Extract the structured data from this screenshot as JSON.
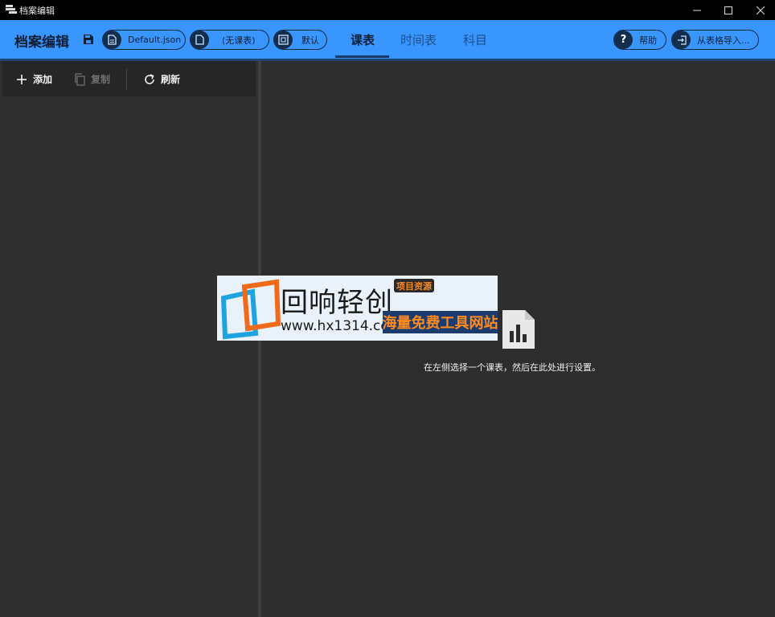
{
  "window": {
    "title": "档案编辑"
  },
  "header": {
    "title": "档案编辑",
    "profile_file": "Default.json",
    "class_plan": "(无课表)",
    "default_label": "默认",
    "tabs": [
      "课表",
      "时间表",
      "科目"
    ],
    "active_tab": "课表",
    "help_label": "帮助",
    "import_label": "从表格导入..."
  },
  "sidebar": {
    "add_label": "添加",
    "copy_label": "复制",
    "refresh_label": "刷新"
  },
  "main": {
    "empty_message": "在左侧选择一个课表，然后在此处进行设置。"
  },
  "watermark": {
    "brand": "回响轻创",
    "url": "www.hx1314.cc",
    "slogan": "海量免费工具网站",
    "badge": "项目资源"
  },
  "colors": {
    "accent": "#3a96ff",
    "background": "#2d2d2d"
  }
}
